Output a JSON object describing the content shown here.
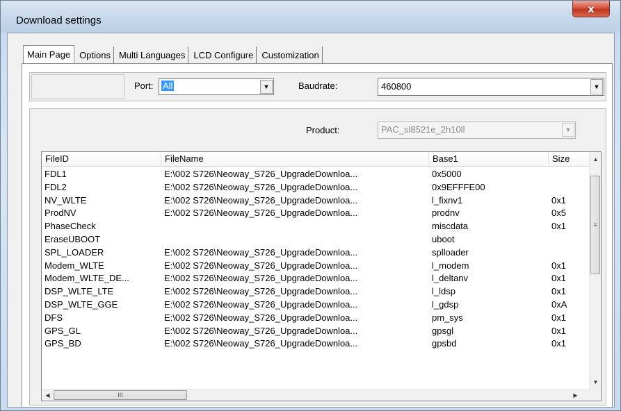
{
  "window": {
    "title": "Download settings",
    "close_glyph": "x"
  },
  "tabs": [
    {
      "label": "Main Page",
      "active": true
    },
    {
      "label": "Options",
      "active": false
    },
    {
      "label": "Multi Languages",
      "active": false
    },
    {
      "label": "LCD Configure",
      "active": false
    },
    {
      "label": "Customization",
      "active": false
    }
  ],
  "port": {
    "label": "Port:",
    "value": "All"
  },
  "baudrate": {
    "label": "Baudrate:",
    "value": "460800"
  },
  "product": {
    "label": "Product:",
    "value": "PAC_sl8521e_2h10ll",
    "disabled": true
  },
  "file_list": {
    "columns": [
      "FileID",
      "FileName",
      "Base1",
      "Size"
    ],
    "rows": [
      {
        "file_id": "FDL1",
        "file_name": "E:\\002 S726\\Neoway_S726_UpgradeDownloa...",
        "base1": "0x5000",
        "size": ""
      },
      {
        "file_id": "FDL2",
        "file_name": "E:\\002 S726\\Neoway_S726_UpgradeDownloa...",
        "base1": "0x9EFFFE00",
        "size": ""
      },
      {
        "file_id": "NV_WLTE",
        "file_name": "E:\\002 S726\\Neoway_S726_UpgradeDownloa...",
        "base1": "l_fixnv1",
        "size": "0x1"
      },
      {
        "file_id": "ProdNV",
        "file_name": "E:\\002 S726\\Neoway_S726_UpgradeDownloa...",
        "base1": "prodnv",
        "size": "0x5"
      },
      {
        "file_id": "PhaseCheck",
        "file_name": "",
        "base1": "miscdata",
        "size": "0x1"
      },
      {
        "file_id": "EraseUBOOT",
        "file_name": "",
        "base1": "uboot",
        "size": ""
      },
      {
        "file_id": "SPL_LOADER",
        "file_name": "E:\\002 S726\\Neoway_S726_UpgradeDownloa...",
        "base1": "splloader",
        "size": ""
      },
      {
        "file_id": "Modem_WLTE",
        "file_name": "E:\\002 S726\\Neoway_S726_UpgradeDownloa...",
        "base1": "l_modem",
        "size": "0x1"
      },
      {
        "file_id": "Modem_WLTE_DE...",
        "file_name": "E:\\002 S726\\Neoway_S726_UpgradeDownloa...",
        "base1": "l_deltanv",
        "size": "0x1"
      },
      {
        "file_id": "DSP_WLTE_LTE",
        "file_name": "E:\\002 S726\\Neoway_S726_UpgradeDownloa...",
        "base1": "l_ldsp",
        "size": "0x1"
      },
      {
        "file_id": "DSP_WLTE_GGE",
        "file_name": "E:\\002 S726\\Neoway_S726_UpgradeDownloa...",
        "base1": "l_gdsp",
        "size": "0xA"
      },
      {
        "file_id": "DFS",
        "file_name": "E:\\002 S726\\Neoway_S726_UpgradeDownloa...",
        "base1": "pm_sys",
        "size": "0x1"
      },
      {
        "file_id": "GPS_GL",
        "file_name": "E:\\002 S726\\Neoway_S726_UpgradeDownloa...",
        "base1": "gpsgl",
        "size": "0x1"
      },
      {
        "file_id": "GPS_BD",
        "file_name": "E:\\002 S726\\Neoway_S726_UpgradeDownloa...",
        "base1": "gpsbd",
        "size": "0x1"
      }
    ]
  },
  "scrollbars": {
    "up": "▲",
    "down": "▼",
    "left": "◀",
    "right": "▶",
    "v_grip": "≡",
    "h_grip": "III"
  },
  "combo_arrow": "▼"
}
